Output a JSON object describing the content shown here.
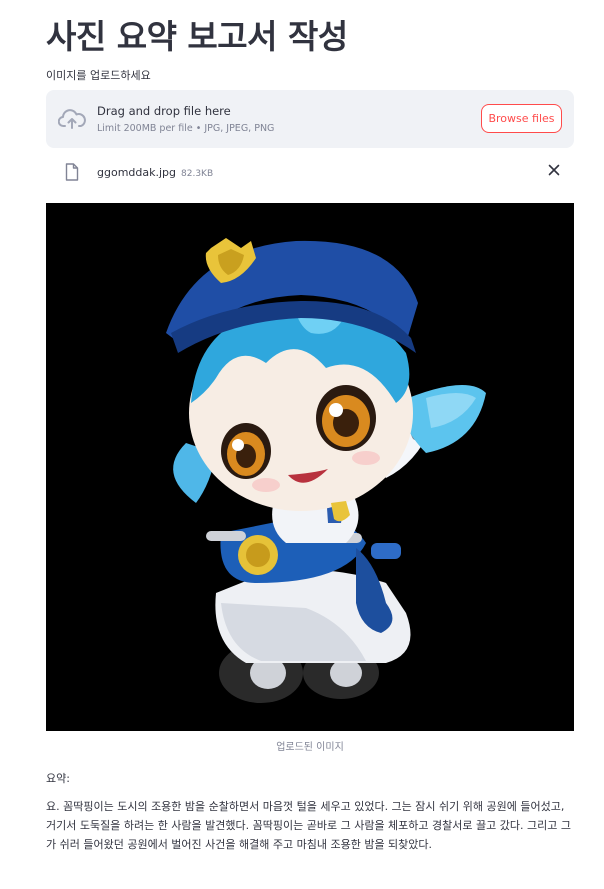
{
  "title": "사진 요약 보고서 작성",
  "uploader": {
    "label": "이미지를 업로드하세요",
    "drag_text": "Drag and drop file here",
    "limit_text": "Limit 200MB per file • JPG, JPEG, PNG",
    "browse_label": "Browse files",
    "icon": "cloud-upload-icon"
  },
  "file": {
    "name": "ggomddak.jpg",
    "size": "82.3KB",
    "icon": "file-icon",
    "remove_icon": "close-icon"
  },
  "image": {
    "caption": "업로드된 이미지",
    "background": "#000000"
  },
  "summary": {
    "label": "요약:",
    "text": "요. 꼼딱핑이는 도시의 조용한 밤을 순찰하면서 마음껏 털을 세우고 있었다. 그는 잠시 쉬기 위해 공원에 들어섰고, 거기서 도둑질을 하려는 한 사람을 발견했다. 꼼딱핑이는 곧바로 그 사람을 체포하고 경찰서로 끌고 갔다. 그리고 그가 쉬러 들어왔던 공원에서 벌어진 사건을 해결해 주고 마침내 조용한 밤을 되찾았다."
  },
  "colors": {
    "accent": "#ff4b4b",
    "dropzone_bg": "#f0f2f6",
    "text": "#31333f",
    "muted": "#808495"
  }
}
